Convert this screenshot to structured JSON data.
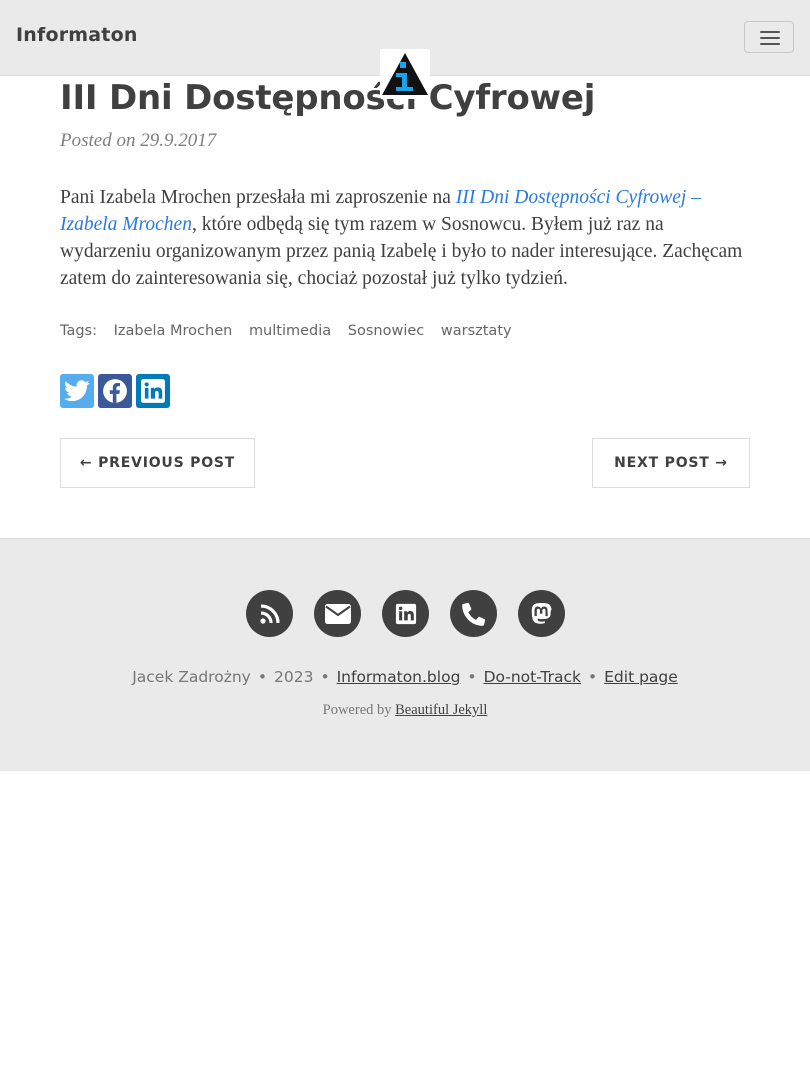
{
  "navbar": {
    "brand": "Informaton",
    "menu_icon": "hamburger-icon",
    "avatar_icon": "informaton-logo"
  },
  "post": {
    "title": "III Dni Dostępności Cyfrowej",
    "meta": "Posted on 29.9.2017",
    "body_before_link": "Pani Izabela Mrochen przesłała mi zaproszenie na ",
    "link_text": "III Dni Dostępności Cyfrowej – Izabela Mrochen",
    "body_after_link": ", które odbędą się tym razem w Sosnowcu. Byłem już raz na wydarzeniu organizowanym przez panią Izabelę i było to nader interesujące. Zachęcam zatem do zainteresowania się, chociaż pozostał już tylko tydzień."
  },
  "tags": {
    "label": "Tags:",
    "items": [
      "Izabela Mrochen",
      "multimedia",
      "Sosnowiec",
      "warsztaty"
    ]
  },
  "share": [
    "twitter-icon",
    "facebook-icon",
    "linkedin-icon"
  ],
  "pager": {
    "previous": "← PREVIOUS POST",
    "next": "NEXT POST →"
  },
  "footer": {
    "social_icons": [
      "rss-icon",
      "envelope-icon",
      "linkedin-icon",
      "phone-icon",
      "mastodon-icon"
    ],
    "author": "Jacek Zadrożny",
    "year": "2023",
    "site": "Informaton.blog",
    "dnt": "Do-not-Track",
    "edit": "Edit page",
    "separator": "•",
    "powered_prefix": "Powered by",
    "powered_name": "Beautiful Jekyll"
  },
  "colors": {
    "accent_link": "#2a7ae2",
    "footer_bg": "#eaeaea",
    "icon_circle": "#404040",
    "twitter": "#55acee",
    "facebook": "#3b5998",
    "linkedin": "#007bb5"
  }
}
